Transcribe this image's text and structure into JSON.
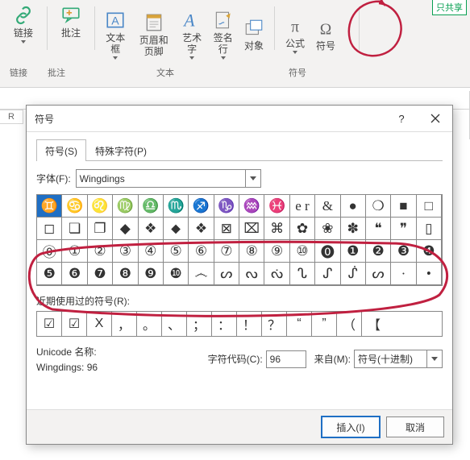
{
  "tag_tab": "只共享",
  "ribbon": {
    "link": "链接",
    "comment": "批注",
    "textbox": "文本框",
    "headerfooter": "页眉和页脚",
    "wordart": "艺术字",
    "signature": "签名行",
    "object": "对象",
    "equation": "公式",
    "symbol": "符号",
    "grp_link": "链接",
    "grp_comment": "批注",
    "grp_text": "文本",
    "grp_symbol": "符号"
  },
  "sheet": {
    "rowR": "R"
  },
  "dialog": {
    "title": "符号",
    "tab_symbol": "符号(S)",
    "tab_special": "特殊字符(P)",
    "font_label": "字体(F):",
    "font_value": "Wingdings",
    "grid": [
      [
        "♊",
        "♋",
        "♌",
        "♍",
        "♎",
        "♏",
        "♐",
        "♑",
        "♒",
        "♓",
        "e r",
        "&",
        "●",
        "❍",
        "■",
        "□"
      ],
      [
        "◻",
        "❏",
        "❐",
        "◆",
        "❖",
        "⬥",
        "❖",
        "⊠",
        "⌧",
        "⌘",
        "✿",
        "❀",
        "✽",
        "❝",
        "❞",
        "▯"
      ],
      [
        "⓪",
        "①",
        "②",
        "③",
        "④",
        "⑤",
        "⑥",
        "⑦",
        "⑧",
        "⑨",
        "⑩",
        "⓿",
        "❶",
        "❷",
        "❸",
        "❹"
      ],
      [
        "❺",
        "❻",
        "❼",
        "❽",
        "❾",
        "❿",
        "෴",
        "ᔕ",
        "ᔓ",
        "ᔔ",
        "ᔐ",
        "ᔑ",
        "ᔒ",
        "ᔕ",
        "·",
        "•"
      ]
    ],
    "recent_label": "近期使用过的符号(R):",
    "recent": [
      "☑",
      "☑",
      "Χ",
      "，",
      "。",
      "、",
      "；",
      "：",
      "！",
      "？",
      "“",
      "”",
      "（",
      "【"
    ],
    "uname_label": "Unicode 名称:",
    "uname_value": "Wingdings: 96",
    "code_label": "字符代码(C):",
    "code_value": "96",
    "from_label": "来自(M):",
    "from_value": "符号(十进制)",
    "insert": "插入(I)",
    "cancel": "取消"
  }
}
